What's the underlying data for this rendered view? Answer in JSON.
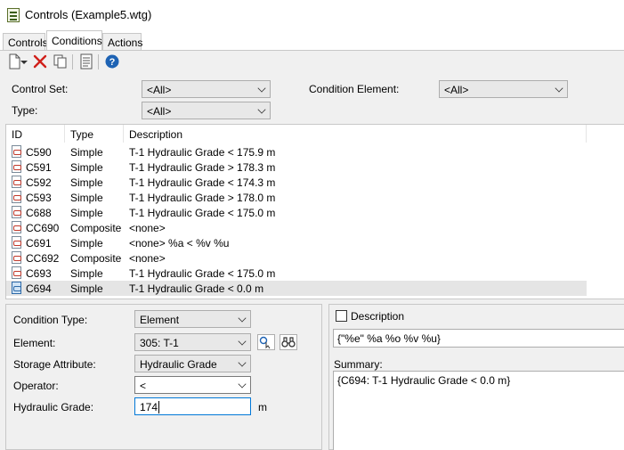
{
  "window": {
    "title": "Controls (Example5.wtg)"
  },
  "tabs": [
    {
      "label": "Controls"
    },
    {
      "label": "Conditions"
    },
    {
      "label": "Actions"
    }
  ],
  "toolbar": {
    "icons": [
      "new-document-icon",
      "dropdown-arrow-icon",
      "delete-icon",
      "copy-icon",
      "report-icon",
      "help-icon"
    ]
  },
  "filters": {
    "control_set_label": "Control Set:",
    "control_set_value": "<All>",
    "condition_element_label": "Condition Element:",
    "condition_element_value": "<All>",
    "type_label": "Type:",
    "type_value": "<All>"
  },
  "table": {
    "columns": [
      "ID",
      "Type",
      "Description"
    ],
    "rows": [
      {
        "id": "C590",
        "type": "Simple",
        "description": "T-1 Hydraulic Grade < 175.9 m"
      },
      {
        "id": "C591",
        "type": "Simple",
        "description": "T-1 Hydraulic Grade > 178.3 m"
      },
      {
        "id": "C592",
        "type": "Simple",
        "description": "T-1 Hydraulic Grade < 174.3 m"
      },
      {
        "id": "C593",
        "type": "Simple",
        "description": "T-1 Hydraulic Grade > 178.0 m"
      },
      {
        "id": "C688",
        "type": "Simple",
        "description": "T-1 Hydraulic Grade < 175.0 m"
      },
      {
        "id": "CC690",
        "type": "Composite",
        "description": "<none>"
      },
      {
        "id": "C691",
        "type": "Simple",
        "description": "<none> %a < %v %u"
      },
      {
        "id": "CC692",
        "type": "Composite",
        "description": "<none>"
      },
      {
        "id": "C693",
        "type": "Simple",
        "description": "T-1 Hydraulic Grade < 175.0 m"
      },
      {
        "id": "C694",
        "type": "Simple",
        "description": "T-1 Hydraulic Grade < 0.0 m"
      }
    ],
    "selected_index": 9
  },
  "editor": {
    "condition_type_label": "Condition Type:",
    "condition_type_value": "Element",
    "element_label": "Element:",
    "element_value": "305: T-1",
    "storage_attribute_label": "Storage Attribute:",
    "storage_attribute_value": "Hydraulic Grade",
    "operator_label": "Operator:",
    "operator_value": "<",
    "hydraulic_grade_label": "Hydraulic Grade:",
    "hydraulic_grade_value": "174",
    "hydraulic_grade_unit": "m"
  },
  "description_panel": {
    "checkbox_label": "Description",
    "template": "{\"%e\" %a %o %v %u}",
    "summary_label": "Summary:",
    "summary_text": "{C694:  T-1 Hydraulic Grade < 0.0 m}"
  }
}
